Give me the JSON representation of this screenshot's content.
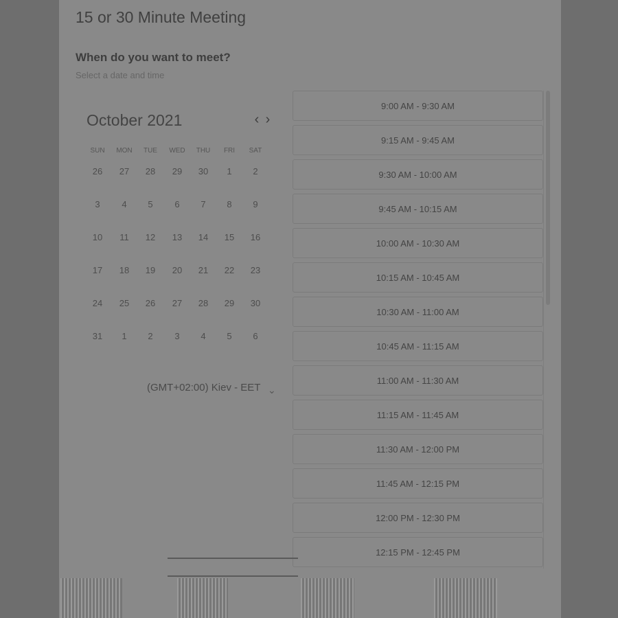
{
  "page": {
    "title": "15 or 30 Minute Meeting",
    "question": "When do you want to meet?",
    "subtitle": "Select a date and time"
  },
  "calendar": {
    "month_label": "October 2021",
    "weekdays": [
      "SUN",
      "MON",
      "TUE",
      "WED",
      "THU",
      "FRI",
      "SAT"
    ],
    "weeks": [
      [
        "26",
        "27",
        "28",
        "29",
        "30",
        "1",
        "2"
      ],
      [
        "3",
        "4",
        "5",
        "6",
        "7",
        "8",
        "9"
      ],
      [
        "10",
        "11",
        "12",
        "13",
        "14",
        "15",
        "16"
      ],
      [
        "17",
        "18",
        "19",
        "20",
        "21",
        "22",
        "23"
      ],
      [
        "24",
        "25",
        "26",
        "27",
        "28",
        "29",
        "30"
      ],
      [
        "31",
        "1",
        "2",
        "3",
        "4",
        "5",
        "6"
      ]
    ],
    "selected": "20"
  },
  "timezone": {
    "label": "(GMT+02:00) Kiev - EET"
  },
  "slots": [
    "9:00 AM - 9:30 AM",
    "9:15 AM - 9:45 AM",
    "9:30 AM - 10:00 AM",
    "9:45 AM - 10:15 AM",
    "10:00 AM - 10:30 AM",
    "10:15 AM - 10:45 AM",
    "10:30 AM - 11:00 AM",
    "10:45 AM - 11:15 AM",
    "11:00 AM - 11:30 AM",
    "11:15 AM - 11:45 AM",
    "11:30 AM - 12:00 PM",
    "11:45 AM - 12:15 PM",
    "12:00 PM - 12:30 PM",
    "12:15 PM - 12:45 PM"
  ]
}
